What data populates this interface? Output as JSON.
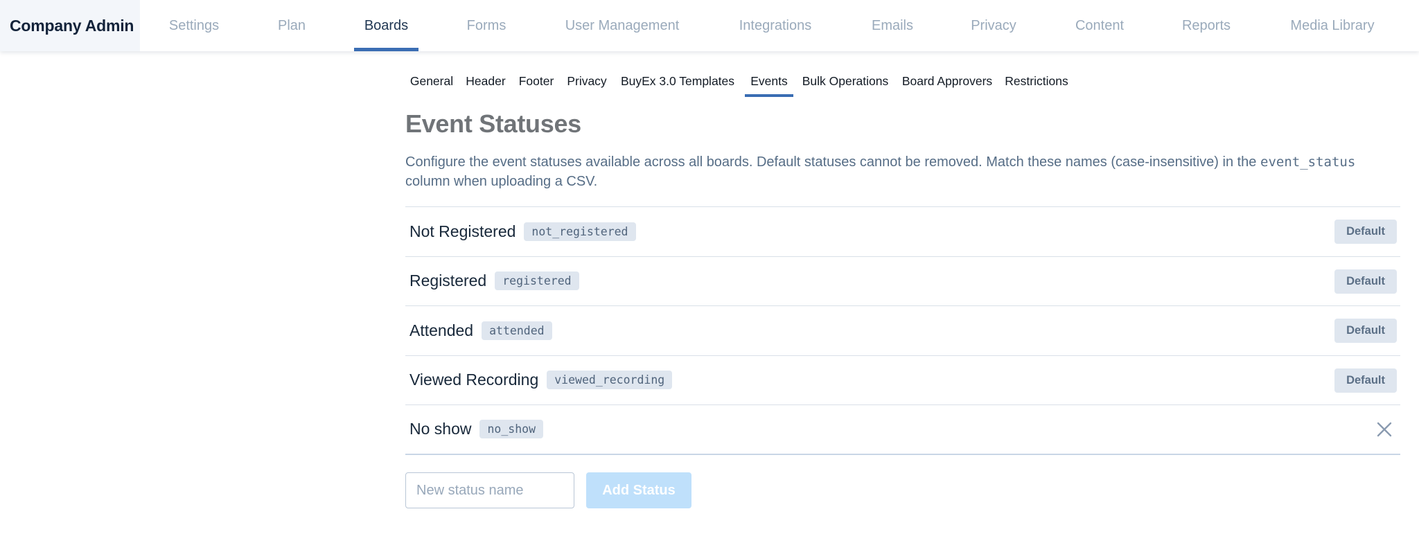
{
  "brand": "Company Admin",
  "nav": {
    "tabs": [
      {
        "label": "Settings"
      },
      {
        "label": "Plan"
      },
      {
        "label": "Boards",
        "active": true
      },
      {
        "label": "Forms"
      },
      {
        "label": "User Management"
      },
      {
        "label": "Integrations"
      },
      {
        "label": "Emails"
      },
      {
        "label": "Privacy"
      },
      {
        "label": "Content"
      },
      {
        "label": "Reports"
      },
      {
        "label": "Media Library"
      }
    ]
  },
  "subnav": {
    "tabs": [
      {
        "label": "General"
      },
      {
        "label": "Header"
      },
      {
        "label": "Footer"
      },
      {
        "label": "Privacy"
      },
      {
        "label": "BuyEx 3.0 Templates"
      },
      {
        "label": "Events",
        "active": true
      },
      {
        "label": "Bulk Operations"
      },
      {
        "label": "Board Approvers"
      },
      {
        "label": "Restrictions"
      }
    ]
  },
  "page": {
    "title": "Event Statuses",
    "description_before": "Configure the event statuses available across all boards. Default statuses cannot be removed. Match these names (case-insensitive) in the",
    "description_code": "event_status",
    "description_after": "column when uploading a CSV."
  },
  "statuses": [
    {
      "name": "Not Registered",
      "key": "not_registered",
      "badge": "Default"
    },
    {
      "name": "Registered",
      "key": "registered",
      "badge": "Default"
    },
    {
      "name": "Attended",
      "key": "attended",
      "badge": "Default"
    },
    {
      "name": "Viewed Recording",
      "key": "viewed_recording",
      "badge": "Default"
    },
    {
      "name": "No show",
      "key": "no_show",
      "removable": true
    }
  ],
  "add_form": {
    "placeholder": "New status name",
    "value": "",
    "button_label": "Add Status"
  },
  "colors": {
    "accent": "#3a6db3",
    "add_button_disabled": "#bfe0fb",
    "chip_bg": "#dfe6ef"
  }
}
